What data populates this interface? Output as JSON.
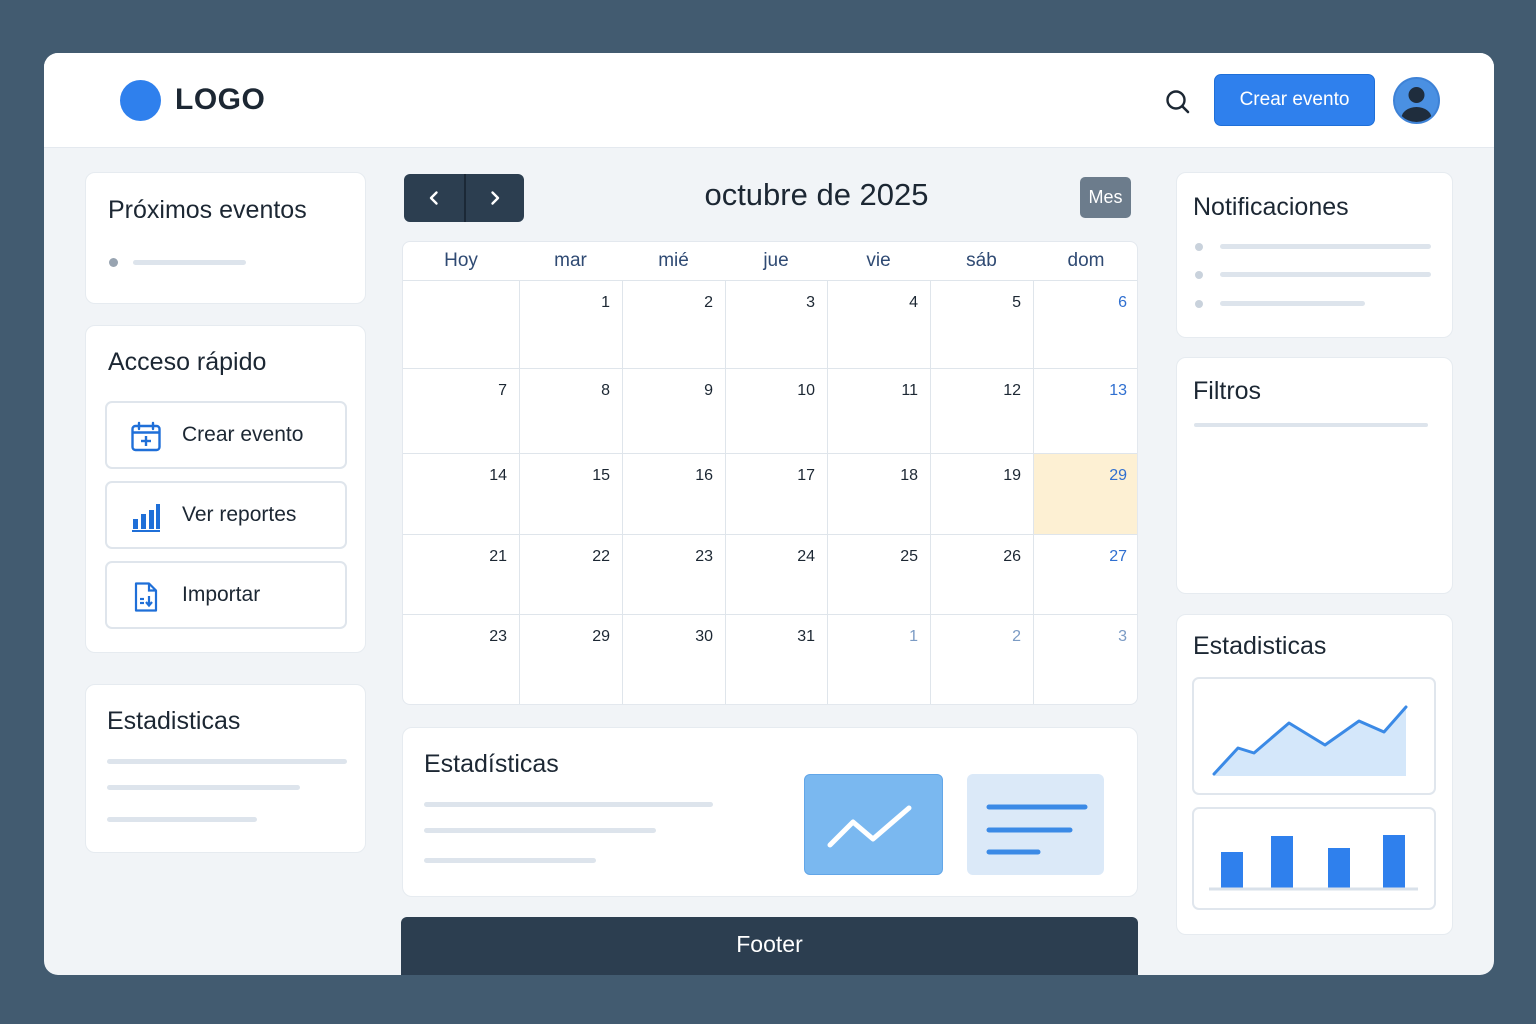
{
  "header": {
    "logo_text": "LOGO",
    "search_icon": "search-icon",
    "create_event_label": "Crear evento",
    "avatar_icon": "user-avatar-icon"
  },
  "upcoming": {
    "title": "Próximos eventos"
  },
  "quick_access": {
    "title": "Acceso rápido",
    "items": [
      {
        "label": "Crear evento",
        "icon": "calendar-plus-icon"
      },
      {
        "label": "Ver reportes",
        "icon": "bar-chart-icon"
      },
      {
        "label": "Importar",
        "icon": "file-import-icon"
      }
    ]
  },
  "left_stats": {
    "title": "Estadisticas"
  },
  "calendar": {
    "prev_icon": "chevron-left-icon",
    "next_icon": "chevron-right-icon",
    "month_title": "octubre de 2025",
    "view_label": "Mes",
    "weekdays": [
      "Hoy",
      "mar",
      "mié",
      "jue",
      "vie",
      "sáb",
      "dom"
    ],
    "weeks": [
      [
        "",
        "1",
        "2",
        "3",
        "4",
        "5",
        "6"
      ],
      [
        "7",
        "8",
        "9",
        "10",
        "11",
        "12",
        "13"
      ],
      [
        "14",
        "15",
        "16",
        "17",
        "18",
        "19",
        "29"
      ],
      [
        "21",
        "22",
        "23",
        "24",
        "25",
        "26",
        "27"
      ],
      [
        "23",
        "29",
        "30",
        "31",
        "1",
        "2",
        "3"
      ]
    ],
    "highlighted_day": "29",
    "accent_color": "#2f80ed",
    "highlight_color": "#fdf0d3"
  },
  "bottom_stats": {
    "title": "Estadísticas"
  },
  "notifications": {
    "title": "Notificaciones"
  },
  "filters": {
    "title": "Filtros"
  },
  "right_stats": {
    "title": "Estadisticas"
  },
  "footer": {
    "label": "Footer"
  }
}
